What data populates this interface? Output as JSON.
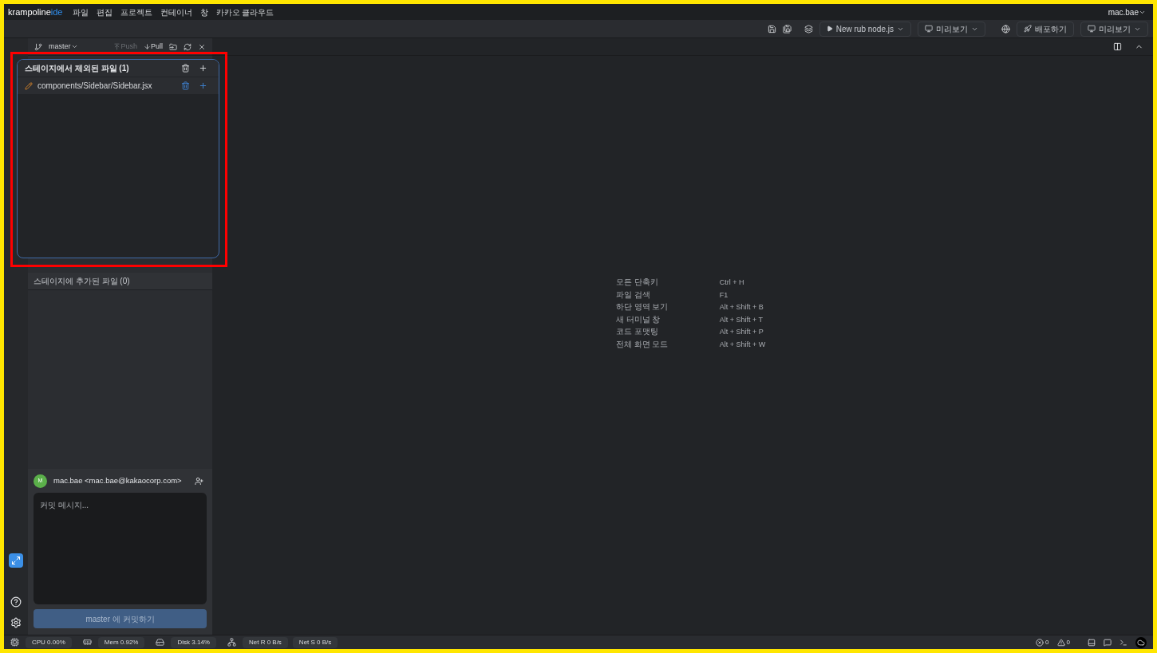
{
  "menu_bar": {
    "logo_main": "krampoline",
    "logo_accent": "ide",
    "items": [
      "파일",
      "편집",
      "프로젝트",
      "컨테이너",
      "창",
      "카카오 클라우드"
    ],
    "user": "mac.bae"
  },
  "toolbar": {
    "run_config": "New rub node.js",
    "preview_1": "미리보기",
    "deploy": "배포하기",
    "preview_2": "미리보기"
  },
  "git_panel": {
    "branch": "master",
    "push": {
      "label": "Push",
      "disabled": true
    },
    "pull": {
      "label": "Pull",
      "disabled": false
    },
    "staged_header": "스테이지에 추가된 파일 (0)",
    "author": "mac.bae <mac.bae@kakaocorp.com>",
    "avatar_letter": "M",
    "commit_message": {
      "placeholder": "커밋 메시지..."
    },
    "commit_button": "master 에 커밋하기"
  },
  "unstaged_popup": {
    "title": "스테이지에서 제외된 파일 (1)",
    "files": [
      {
        "path": "components/Sidebar/Sidebar.jsx"
      }
    ]
  },
  "shortcuts": [
    {
      "label": "모든 단축키",
      "keys": "Ctrl + H"
    },
    {
      "label": "파일 검색",
      "keys": "F1"
    },
    {
      "label": "하단 영역 보기",
      "keys": "Alt + Shift + B"
    },
    {
      "label": "새 터미널 창",
      "keys": "Alt + Shift + T"
    },
    {
      "label": "코드 포맷팅",
      "keys": "Alt + Shift + P"
    },
    {
      "label": "전체 화면 모드",
      "keys": "Alt + Shift + W"
    }
  ],
  "status_bar": {
    "cpu": "CPU 0.00%",
    "mem": "Mem 0.92%",
    "disk": "Disk 3.14%",
    "net_r": "Net R 0 B/s",
    "net_s": "Net S 0 B/s",
    "errors": "0",
    "warnings": "0"
  }
}
